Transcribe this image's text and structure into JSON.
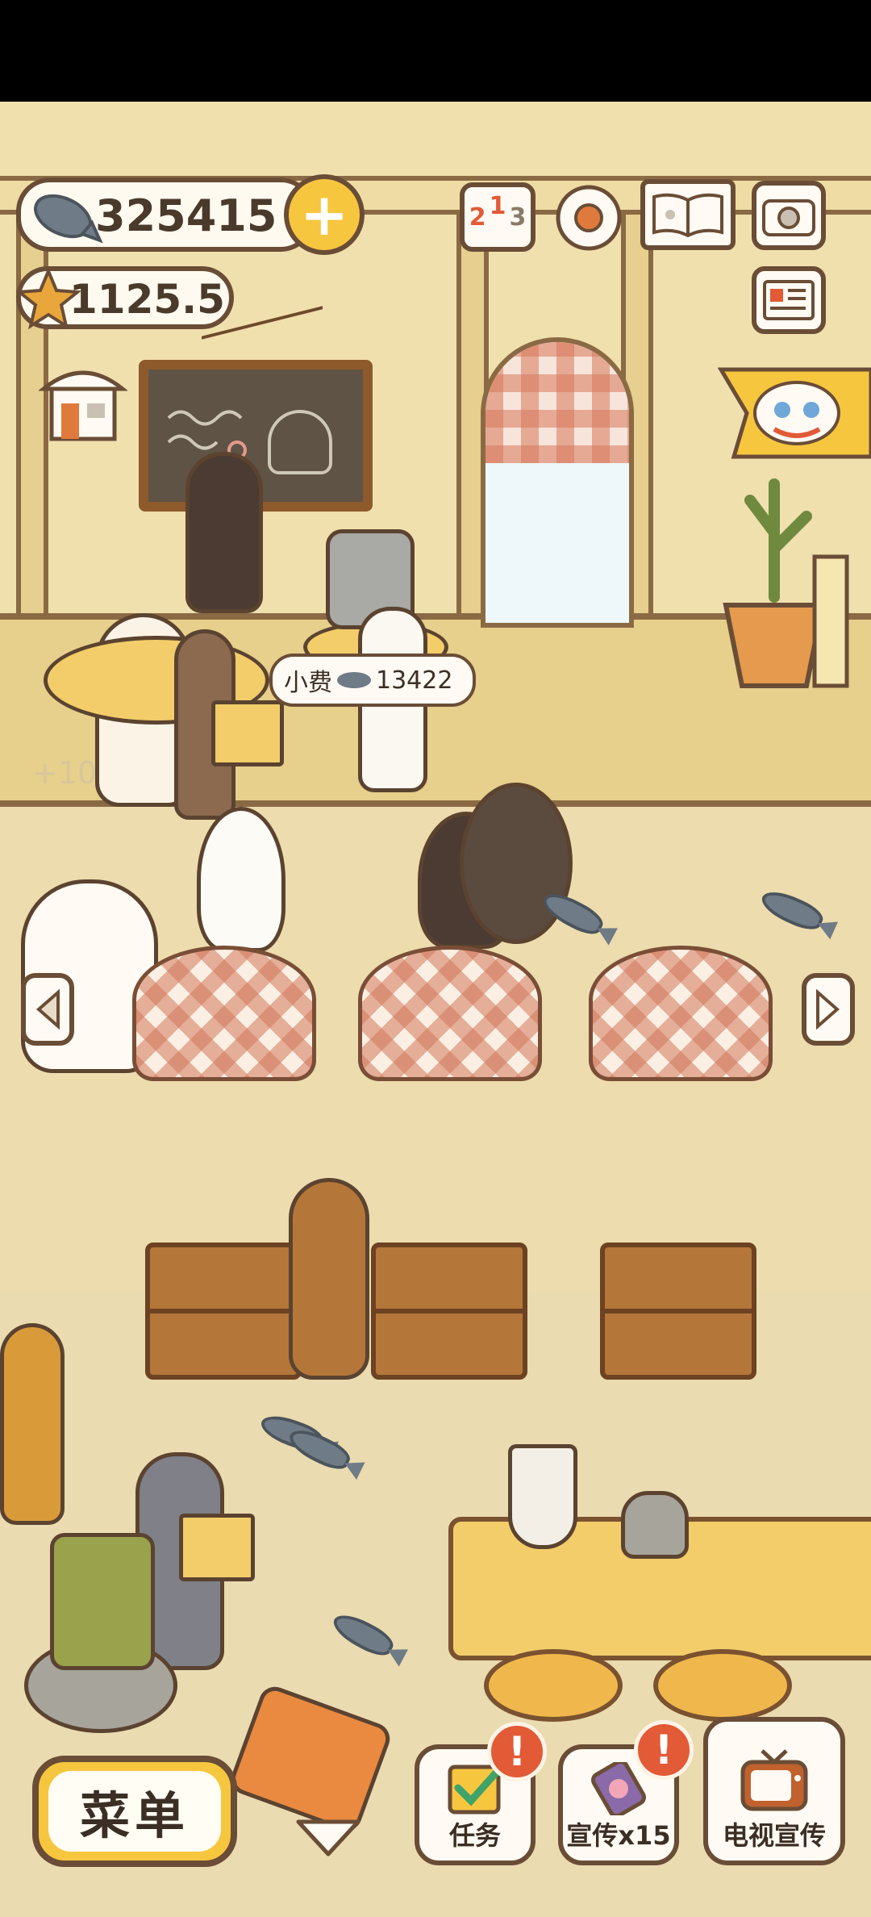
{
  "hud": {
    "fish_count": "325415",
    "star_count": "1125.5",
    "ranking_digits": [
      "2",
      "1",
      "3"
    ]
  },
  "tip_bubble": {
    "label": "小费",
    "amount": "13422"
  },
  "faded_counter": "+10",
  "bottom_bar": {
    "menu_label": "菜单",
    "tasks_label": "任务",
    "promo_label": "宣传x15",
    "tv_promo_label": "电视宣传",
    "alert_mark": "!"
  },
  "colors": {
    "accent_yellow": "#f7c63f",
    "outline_brown": "#6a4d36",
    "alert_red": "#e25a36",
    "wall": "#f0e0ae"
  },
  "icons": [
    "fish-icon",
    "star-icon",
    "plus-icon",
    "ranking-icon",
    "settings-gear-icon",
    "book-icon",
    "camera-icon",
    "news-card-icon",
    "shop-icon",
    "lion-dance-icon",
    "arrow-left-icon",
    "arrow-right-icon",
    "chevron-down-icon",
    "checkbox-icon",
    "phone-promo-icon",
    "tv-icon"
  ]
}
